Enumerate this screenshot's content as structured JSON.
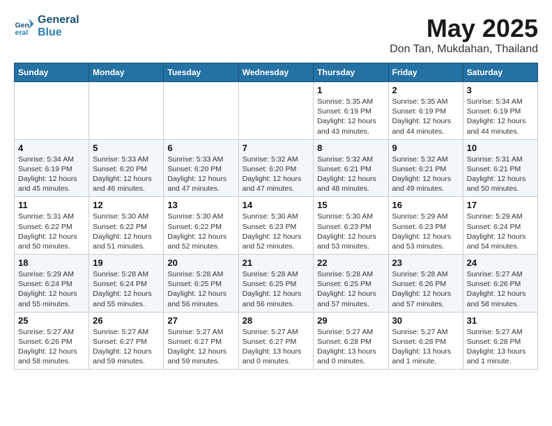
{
  "logo": {
    "line1": "General",
    "line2": "Blue"
  },
  "title": "May 2025",
  "subtitle": "Don Tan, Mukdahan, Thailand",
  "weekdays": [
    "Sunday",
    "Monday",
    "Tuesday",
    "Wednesday",
    "Thursday",
    "Friday",
    "Saturday"
  ],
  "weeks": [
    [
      {
        "day": "",
        "info": ""
      },
      {
        "day": "",
        "info": ""
      },
      {
        "day": "",
        "info": ""
      },
      {
        "day": "",
        "info": ""
      },
      {
        "day": "1",
        "info": "Sunrise: 5:35 AM\nSunset: 6:19 PM\nDaylight: 12 hours\nand 43 minutes."
      },
      {
        "day": "2",
        "info": "Sunrise: 5:35 AM\nSunset: 6:19 PM\nDaylight: 12 hours\nand 44 minutes."
      },
      {
        "day": "3",
        "info": "Sunrise: 5:34 AM\nSunset: 6:19 PM\nDaylight: 12 hours\nand 44 minutes."
      }
    ],
    [
      {
        "day": "4",
        "info": "Sunrise: 5:34 AM\nSunset: 6:19 PM\nDaylight: 12 hours\nand 45 minutes."
      },
      {
        "day": "5",
        "info": "Sunrise: 5:33 AM\nSunset: 6:20 PM\nDaylight: 12 hours\nand 46 minutes."
      },
      {
        "day": "6",
        "info": "Sunrise: 5:33 AM\nSunset: 6:20 PM\nDaylight: 12 hours\nand 47 minutes."
      },
      {
        "day": "7",
        "info": "Sunrise: 5:32 AM\nSunset: 6:20 PM\nDaylight: 12 hours\nand 47 minutes."
      },
      {
        "day": "8",
        "info": "Sunrise: 5:32 AM\nSunset: 6:21 PM\nDaylight: 12 hours\nand 48 minutes."
      },
      {
        "day": "9",
        "info": "Sunrise: 5:32 AM\nSunset: 6:21 PM\nDaylight: 12 hours\nand 49 minutes."
      },
      {
        "day": "10",
        "info": "Sunrise: 5:31 AM\nSunset: 6:21 PM\nDaylight: 12 hours\nand 50 minutes."
      }
    ],
    [
      {
        "day": "11",
        "info": "Sunrise: 5:31 AM\nSunset: 6:22 PM\nDaylight: 12 hours\nand 50 minutes."
      },
      {
        "day": "12",
        "info": "Sunrise: 5:30 AM\nSunset: 6:22 PM\nDaylight: 12 hours\nand 51 minutes."
      },
      {
        "day": "13",
        "info": "Sunrise: 5:30 AM\nSunset: 6:22 PM\nDaylight: 12 hours\nand 52 minutes."
      },
      {
        "day": "14",
        "info": "Sunrise: 5:30 AM\nSunset: 6:23 PM\nDaylight: 12 hours\nand 52 minutes."
      },
      {
        "day": "15",
        "info": "Sunrise: 5:30 AM\nSunset: 6:23 PM\nDaylight: 12 hours\nand 53 minutes."
      },
      {
        "day": "16",
        "info": "Sunrise: 5:29 AM\nSunset: 6:23 PM\nDaylight: 12 hours\nand 53 minutes."
      },
      {
        "day": "17",
        "info": "Sunrise: 5:29 AM\nSunset: 6:24 PM\nDaylight: 12 hours\nand 54 minutes."
      }
    ],
    [
      {
        "day": "18",
        "info": "Sunrise: 5:29 AM\nSunset: 6:24 PM\nDaylight: 12 hours\nand 55 minutes."
      },
      {
        "day": "19",
        "info": "Sunrise: 5:28 AM\nSunset: 6:24 PM\nDaylight: 12 hours\nand 55 minutes."
      },
      {
        "day": "20",
        "info": "Sunrise: 5:28 AM\nSunset: 6:25 PM\nDaylight: 12 hours\nand 56 minutes."
      },
      {
        "day": "21",
        "info": "Sunrise: 5:28 AM\nSunset: 6:25 PM\nDaylight: 12 hours\nand 56 minutes."
      },
      {
        "day": "22",
        "info": "Sunrise: 5:28 AM\nSunset: 6:25 PM\nDaylight: 12 hours\nand 57 minutes."
      },
      {
        "day": "23",
        "info": "Sunrise: 5:28 AM\nSunset: 6:26 PM\nDaylight: 12 hours\nand 57 minutes."
      },
      {
        "day": "24",
        "info": "Sunrise: 5:27 AM\nSunset: 6:26 PM\nDaylight: 12 hours\nand 58 minutes."
      }
    ],
    [
      {
        "day": "25",
        "info": "Sunrise: 5:27 AM\nSunset: 6:26 PM\nDaylight: 12 hours\nand 58 minutes."
      },
      {
        "day": "26",
        "info": "Sunrise: 5:27 AM\nSunset: 6:27 PM\nDaylight: 12 hours\nand 59 minutes."
      },
      {
        "day": "27",
        "info": "Sunrise: 5:27 AM\nSunset: 6:27 PM\nDaylight: 12 hours\nand 59 minutes."
      },
      {
        "day": "28",
        "info": "Sunrise: 5:27 AM\nSunset: 6:27 PM\nDaylight: 13 hours\nand 0 minutes."
      },
      {
        "day": "29",
        "info": "Sunrise: 5:27 AM\nSunset: 6:28 PM\nDaylight: 13 hours\nand 0 minutes."
      },
      {
        "day": "30",
        "info": "Sunrise: 5:27 AM\nSunset: 6:28 PM\nDaylight: 13 hours\nand 1 minute."
      },
      {
        "day": "31",
        "info": "Sunrise: 5:27 AM\nSunset: 6:28 PM\nDaylight: 13 hours\nand 1 minute."
      }
    ]
  ]
}
